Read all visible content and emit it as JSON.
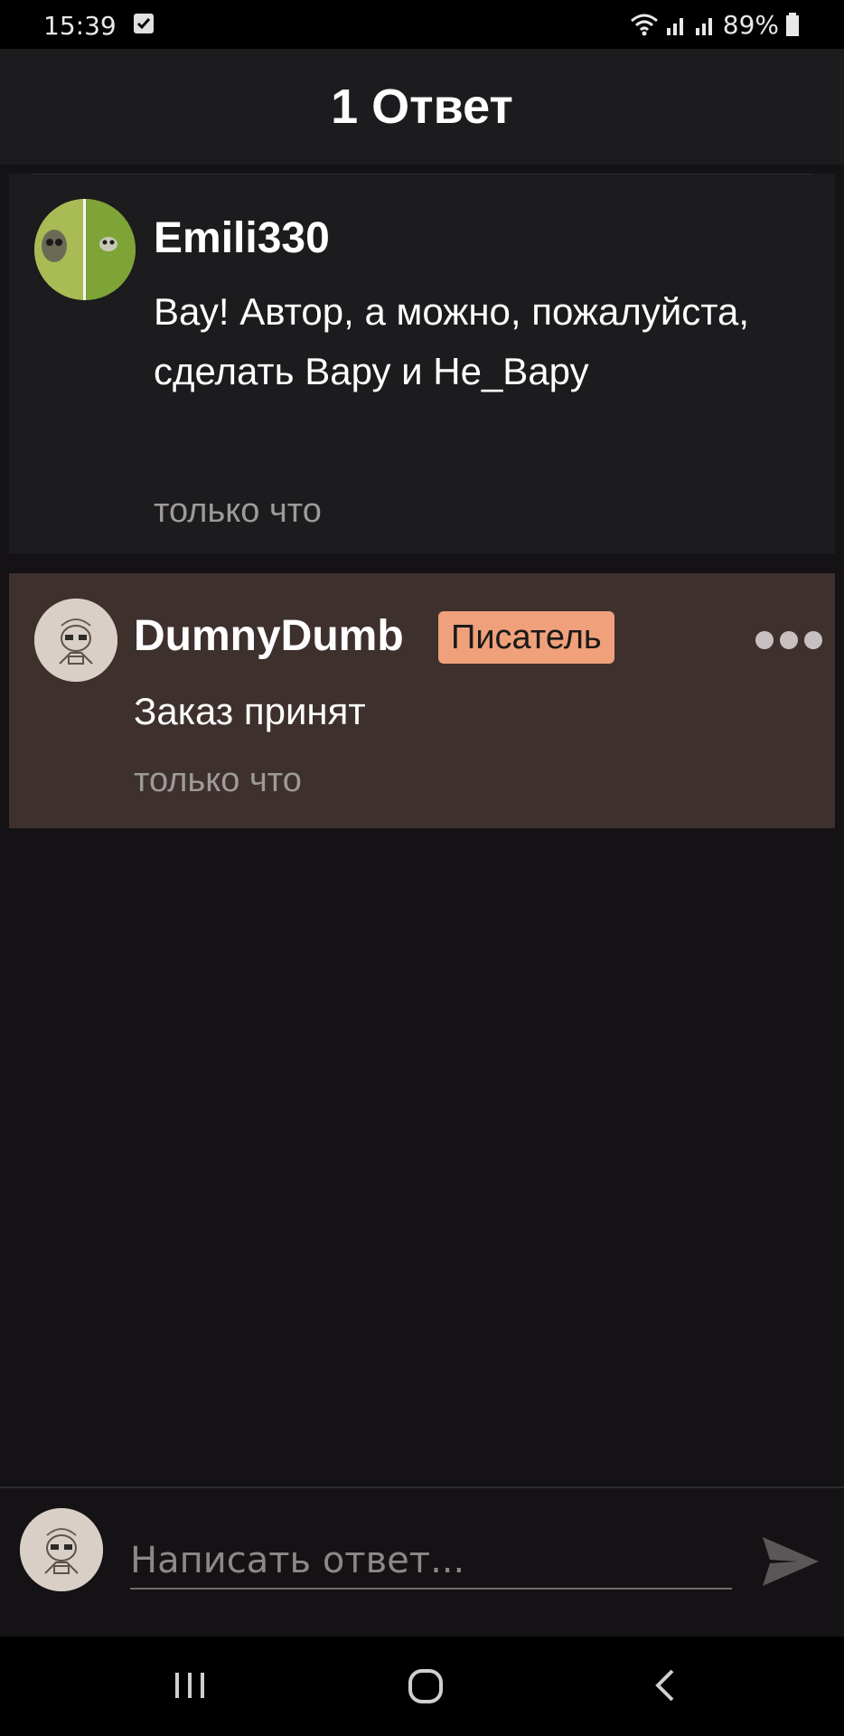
{
  "status_bar": {
    "time": "15:39",
    "battery": "89%",
    "icons": [
      "check-icon",
      "wifi-icon",
      "signal-icon",
      "signal-icon",
      "battery-icon"
    ]
  },
  "header": {
    "title": "1 Ответ"
  },
  "parent_comment": {
    "username": "Emili330",
    "text": "Вау! Автор, а можно, пожалуйста,  сделать Вару и Не_Вару",
    "timestamp": "только что"
  },
  "reply_comment": {
    "username": "DumnyDumb",
    "badge": "Писатель",
    "text": "Заказ принят",
    "timestamp": "только что",
    "menu_icon": "more-icon"
  },
  "composer": {
    "placeholder": "Написать ответ...",
    "send_icon": "send-icon"
  },
  "nav_bar": {
    "icons": [
      "recent-apps-icon",
      "home-icon",
      "back-icon"
    ]
  },
  "colors": {
    "background": "#141215",
    "surface": "#1c1b1e",
    "reply_highlight": "#3e302d",
    "badge": "#f0a07a",
    "muted_text": "#9e9a9a"
  }
}
